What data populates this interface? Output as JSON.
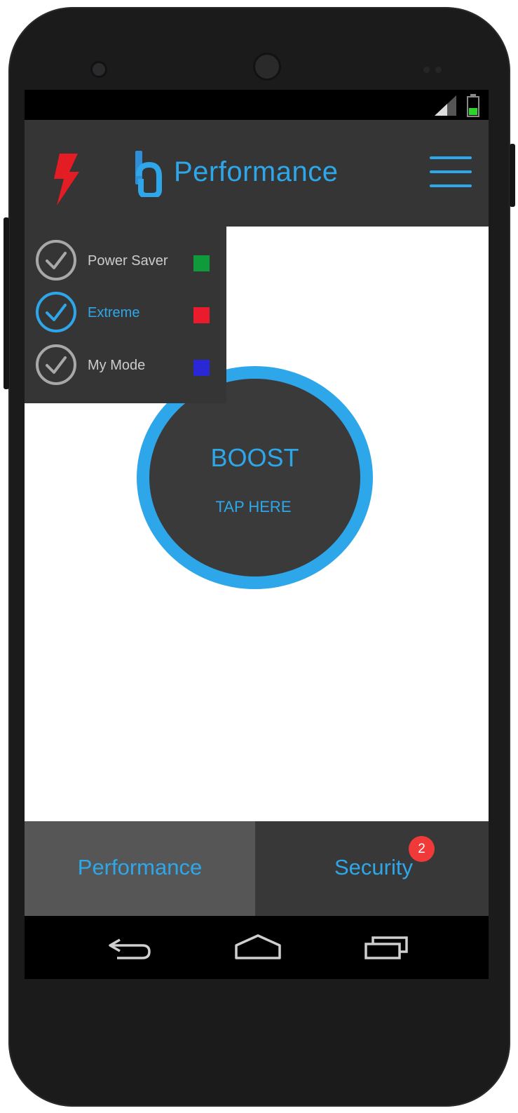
{
  "status_bar": {
    "signal_icon": "cell-signal-icon",
    "battery_icon": "battery-icon",
    "battery_color": "#2cd42c"
  },
  "app_bar": {
    "bolt_icon": "lightning-bolt-icon",
    "logo_icon": "app-logo-icon",
    "title": "Performance",
    "menu_icon": "hamburger-menu-icon",
    "accent_color": "#2ea7ea",
    "bolt_color": "#e41c24"
  },
  "modes": [
    {
      "label": "Power Saver",
      "color": "#0f9b3c",
      "selected": false
    },
    {
      "label": "Extreme",
      "color": "#ea1b2d",
      "selected": true
    },
    {
      "label": "My Mode",
      "color": "#2a27d6",
      "selected": false
    }
  ],
  "boost": {
    "title": "BOOST",
    "subtitle": "TAP HERE"
  },
  "tabs": [
    {
      "label": "Performance",
      "active": true
    },
    {
      "label": "Security",
      "active": false,
      "badge": "2"
    }
  ],
  "nav_bar": {
    "back_icon": "back-icon",
    "home_icon": "home-icon",
    "recents_icon": "recents-icon"
  }
}
